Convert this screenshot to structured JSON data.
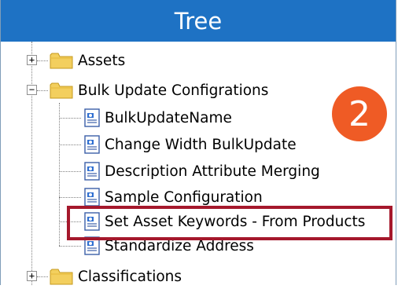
{
  "header": {
    "title": "Tree"
  },
  "tree": {
    "nodes": [
      {
        "label": "Assets",
        "expander": "+"
      },
      {
        "label": "Bulk Update Configrations",
        "expander": "−",
        "children": [
          {
            "label": "BulkUpdateName"
          },
          {
            "label": "Change Width BulkUpdate"
          },
          {
            "label": "Description Attribute Merging"
          },
          {
            "label": "Sample Configuration"
          },
          {
            "label": "Set Asset Keywords - From Products",
            "highlighted": true
          },
          {
            "label": "Standardize Address"
          }
        ]
      },
      {
        "label": "Classifications",
        "expander": "+"
      }
    ]
  },
  "callout": {
    "number": "2"
  },
  "colors": {
    "header_bg": "#1e72c4",
    "badge_bg": "#ef5b25",
    "highlight_border": "#a5182c",
    "folder": "#f3cf5e"
  },
  "icons": {
    "folder": "folder-icon",
    "config": "config-document-icon"
  }
}
